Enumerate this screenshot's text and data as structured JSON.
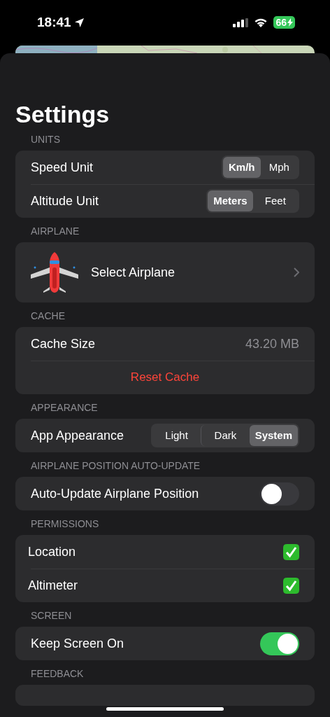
{
  "status_bar": {
    "time": "18:41",
    "battery": "66"
  },
  "title": "Settings",
  "sections": [
    {
      "header": "UNITS",
      "rows": [
        {
          "kind": "segmented",
          "label": "Speed Unit",
          "options": [
            {
              "label": "Km/h",
              "selected": true
            },
            {
              "label": "Mph",
              "selected": false
            }
          ]
        },
        {
          "kind": "segmented",
          "label": "Altitude Unit",
          "options": [
            {
              "label": "Meters",
              "selected": true
            },
            {
              "label": "Feet",
              "selected": false
            }
          ]
        }
      ]
    },
    {
      "header": "AIRPLANE",
      "rows": [
        {
          "kind": "link",
          "label": "Select Airplane"
        }
      ]
    },
    {
      "header": "CACHE",
      "rows": [
        {
          "kind": "value",
          "label": "Cache Size",
          "value": "43.20 MB"
        },
        {
          "kind": "action",
          "label": "Reset Cache"
        }
      ]
    },
    {
      "header": "APPEARANCE",
      "rows": [
        {
          "kind": "segmented",
          "label": "App Appearance",
          "options": [
            {
              "label": "Light",
              "selected": false
            },
            {
              "label": "Dark",
              "selected": false
            },
            {
              "label": "System",
              "selected": true
            }
          ]
        }
      ]
    },
    {
      "header": "AIRPLANE POSITION AUTO-UPDATE",
      "rows": [
        {
          "kind": "toggle",
          "label": "Auto-Update Airplane Position",
          "on": false
        }
      ]
    },
    {
      "header": "PERMISSIONS",
      "rows": [
        {
          "kind": "check",
          "label": "Location",
          "checked": true
        },
        {
          "kind": "check",
          "label": "Altimeter",
          "checked": true
        }
      ]
    },
    {
      "header": "SCREEN",
      "rows": [
        {
          "kind": "toggle",
          "label": "Keep Screen On",
          "on": true
        }
      ]
    },
    {
      "header": "FEEDBACK"
    }
  ]
}
